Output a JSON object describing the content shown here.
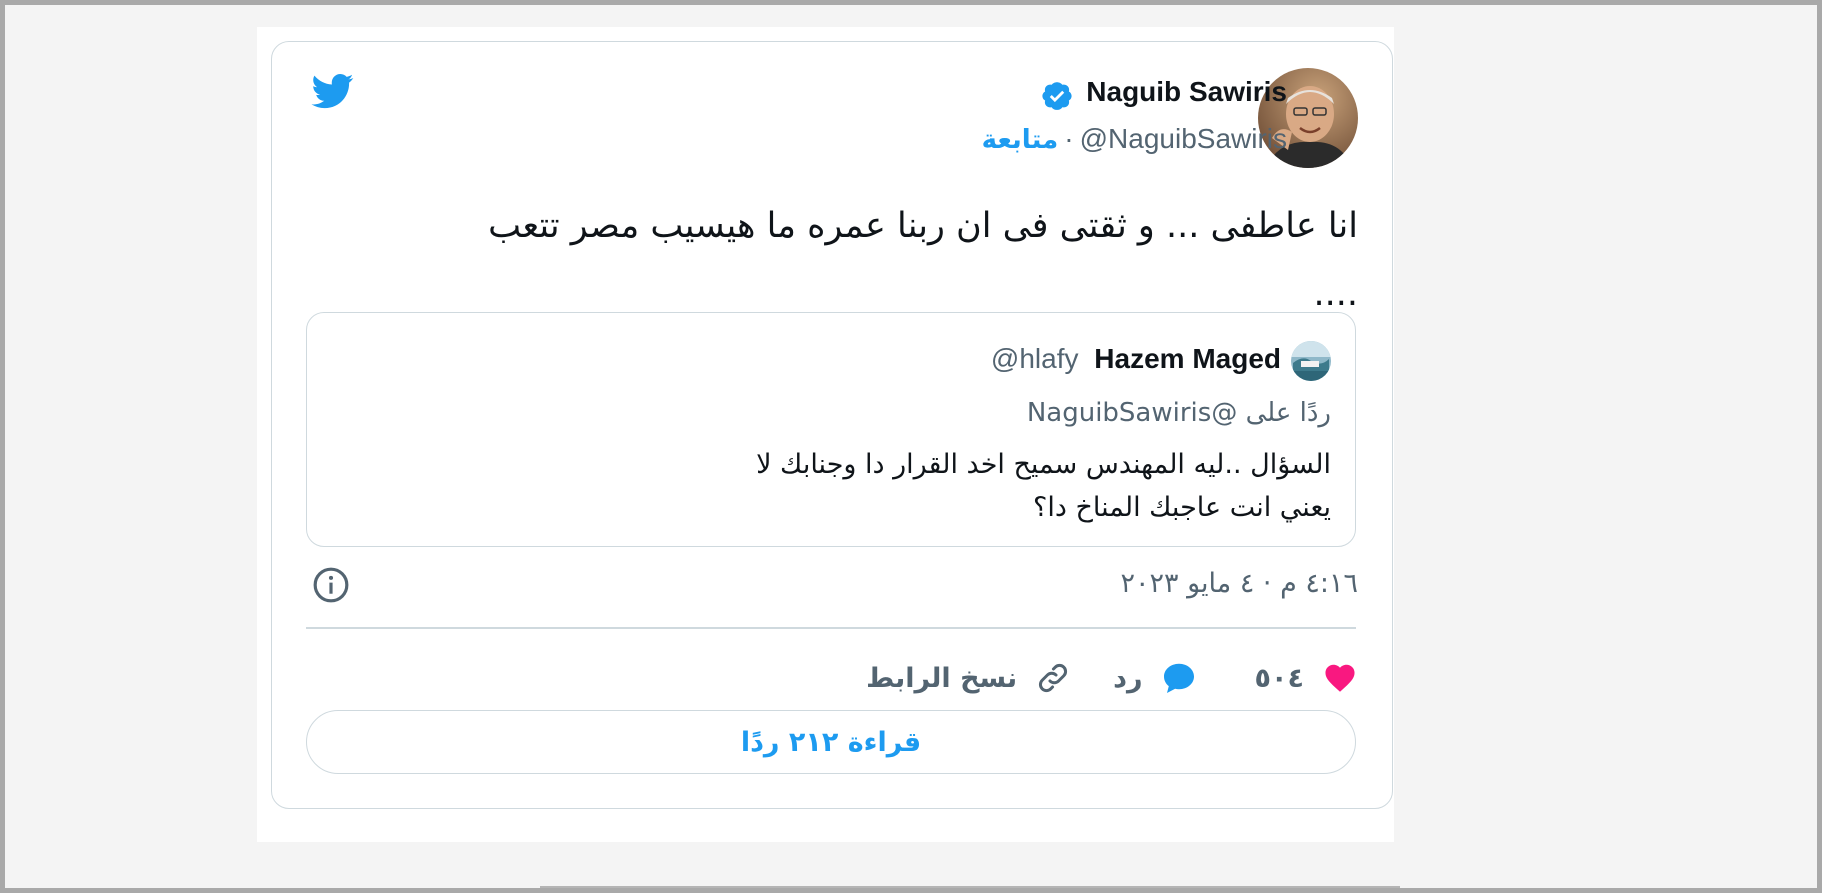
{
  "tweet": {
    "author": {
      "name": "Naguib Sawiris",
      "handle": "@NaguibSawiris",
      "follow_label": "متابعة",
      "separator": "·",
      "verified": true
    },
    "text_line1": "انا عاطفى ... و ثقتى فى ان ربنا عمره ما هيسيب مصر تتعب",
    "text_line2": "....",
    "quoted": {
      "name": "Hazem Maged",
      "handle": "@hlafy",
      "reply_prefix": "ردًا على",
      "reply_to": "@NaguibSawiris",
      "text_line1": "السؤال ..ليه المهندس سميح اخد القرار دا وجنابك لا",
      "text_line2": "يعني انت عاجبك المناخ دا؟"
    },
    "timestamp": "٤:١٦ م · ٤ مايو ٢٠٢٣",
    "actions": {
      "like_count": "٥٠٤",
      "reply_label": "رد",
      "copy_link_label": "نسخ الرابط"
    },
    "read_replies_label": "قراءة ٢١٢ ردًا"
  },
  "icons": {
    "brand": "twitter-bird-icon",
    "verified": "verified-badge-icon",
    "info": "info-icon",
    "like": "heart-icon",
    "reply": "speech-bubble-icon",
    "copy": "link-icon"
  },
  "colors": {
    "twitter_blue": "#1d9bf0",
    "like_pink": "#f91880",
    "text_primary": "#0f1419",
    "text_secondary": "#536471",
    "border": "#cfd9de"
  }
}
